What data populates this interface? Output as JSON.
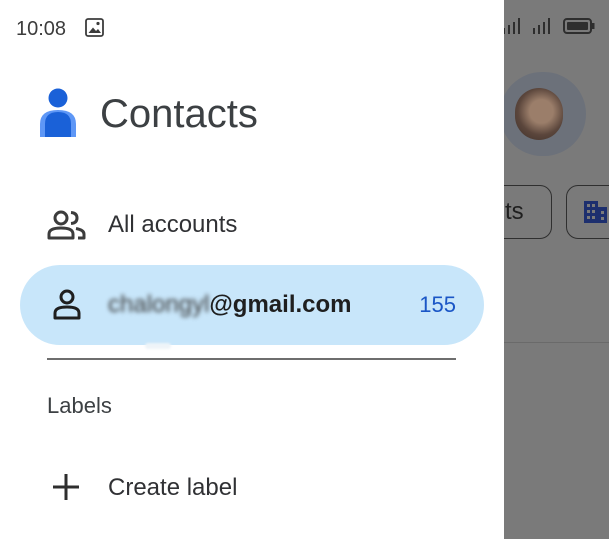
{
  "status_bar": {
    "time": "10:08"
  },
  "background": {
    "chip_text": "ts"
  },
  "drawer": {
    "app_title": "Contacts",
    "all_accounts_label": "All accounts",
    "account": {
      "email_local_obscured": "chalongyl",
      "email_domain": "@gmail.com",
      "contact_count": "155"
    },
    "labels_heading": "Labels",
    "create_label": "Create label"
  },
  "icons": {
    "photo": "image-icon",
    "wifi": "wifi-icon",
    "signal": "signal-icon",
    "battery": "battery-icon",
    "logo": "contacts-logo-icon",
    "all_accounts": "people-icon",
    "account": "person-icon",
    "create": "plus-icon"
  },
  "colors": {
    "accent_blue": "#1a56c6",
    "selected_bg": "#c8e6fa",
    "logo_blue": "#1a61d8",
    "logo_light": "#5e97f6",
    "scrim": "#7a7a7a"
  }
}
